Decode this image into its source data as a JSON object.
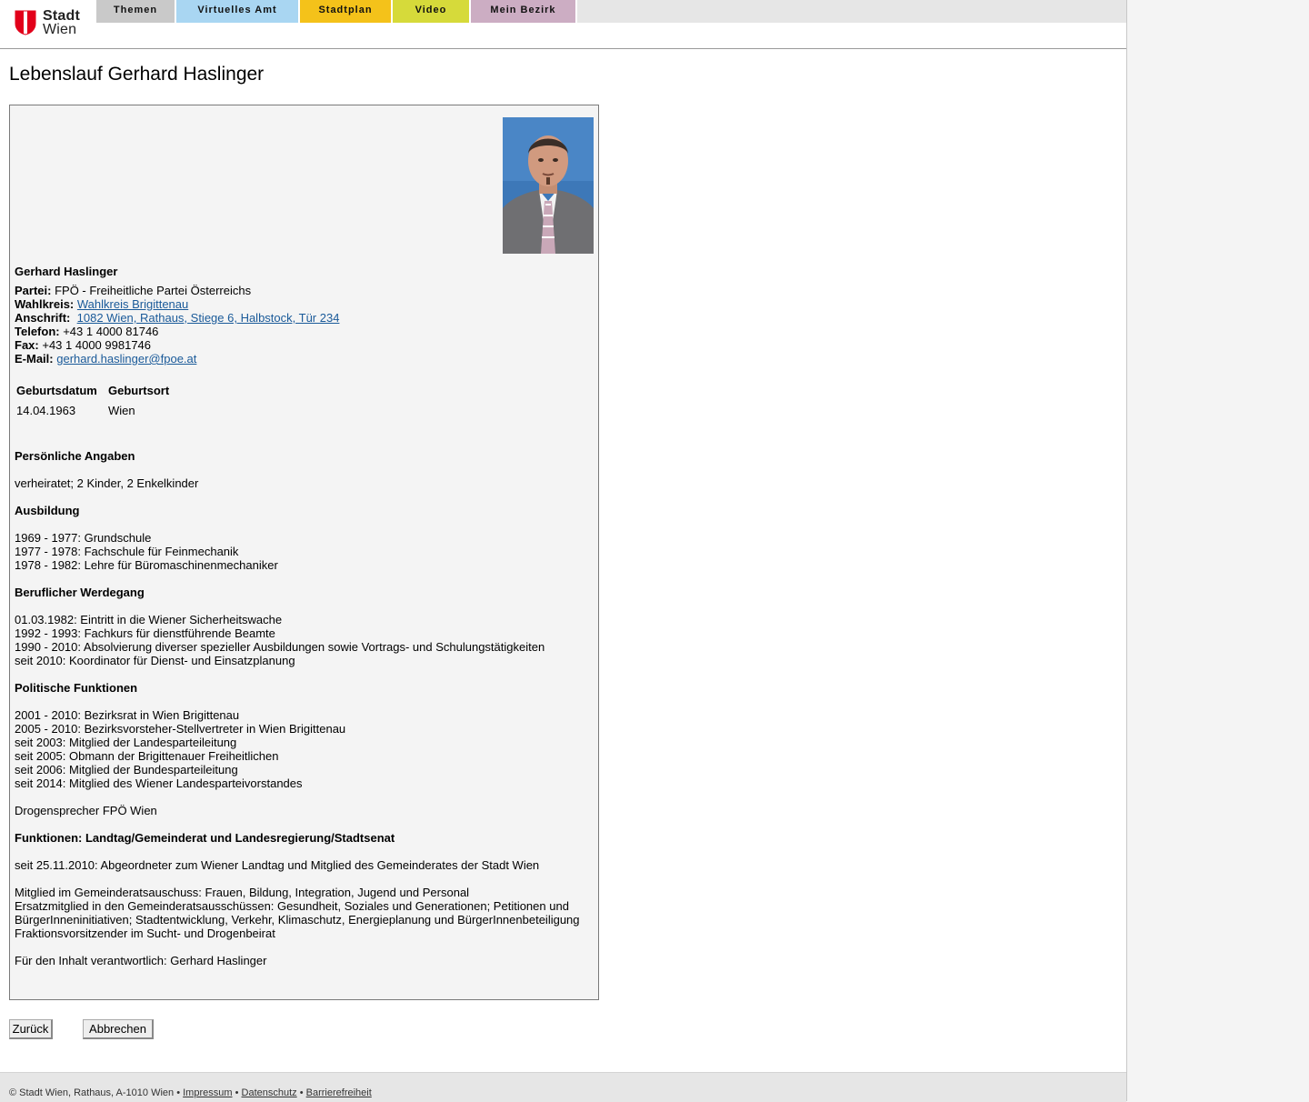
{
  "header": {
    "logo": {
      "line1": "Stadt",
      "line2": "Wien"
    },
    "tabs": [
      {
        "label": "Themen",
        "color": "#c9c9c9"
      },
      {
        "label": "Virtuelles Amt",
        "color": "#a9d6f2"
      },
      {
        "label": "Stadtplan",
        "color": "#f4c21a"
      },
      {
        "label": "Video",
        "color": "#d6da3a"
      },
      {
        "label": "Mein Bezirk",
        "color": "#ccadc3"
      }
    ]
  },
  "page_title": "Lebenslauf Gerhard Haslinger",
  "profile": {
    "name": "Gerhard Haslinger",
    "partei_label": "Partei:",
    "partei": "FPÖ - Freiheitliche Partei Österreichs",
    "wahlkreis_label": "Wahlkreis:",
    "wahlkreis": "Wahlkreis Brigittenau",
    "anschrift_label": "Anschrift:",
    "anschrift": "1082 Wien, Rathaus, Stiege 6, Halbstock, Tür 234",
    "telefon_label": "Telefon:",
    "telefon": "+43 1 4000 81746",
    "fax_label": "Fax:",
    "fax": "+43 1 4000 9981746",
    "email_label": "E-Mail:",
    "email": "gerhard.haslinger@fpoe.at"
  },
  "birth": {
    "headers": [
      "Geburtsdatum",
      "Geburtsort"
    ],
    "values": [
      "14.04.1963",
      "Wien"
    ]
  },
  "sections": {
    "personal_heading": "Persönliche Angaben",
    "personal_text": "verheiratet; 2 Kinder, 2 Enkelkinder",
    "education_heading": "Ausbildung",
    "education": [
      "1969 - 1977: Grundschule",
      "1977 - 1978: Fachschule für Feinmechanik",
      "1978 - 1982: Lehre für Büromaschinenmechaniker"
    ],
    "career_heading": "Beruflicher Werdegang",
    "career": [
      "01.03.1982: Eintritt in die Wiener Sicherheitswache",
      "1992 - 1993: Fachkurs für dienstführende Beamte",
      "1990 - 2010: Absolvierung diverser spezieller Ausbildungen sowie Vortrags- und Schulungstätigkeiten",
      "seit 2010: Koordinator für Dienst- und Einsatzplanung"
    ],
    "political_heading": "Politische Funktionen",
    "political": [
      "2001 - 2010: Bezirksrat in Wien Brigittenau",
      "2005 - 2010: Bezirksvorsteher-Stellvertreter in Wien Brigittenau",
      "seit 2003: Mitglied der Landesparteileitung",
      "seit 2005: Obmann der Brigittenauer Freiheitlichen",
      "seit 2006: Mitglied der Bundesparteileitung",
      "seit 2014: Mitglied des Wiener Landesparteivorstandes"
    ],
    "drogen": "Drogensprecher FPÖ Wien",
    "functions_heading": "Funktionen: Landtag/Gemeinderat und Landesregierung/Stadtsenat",
    "functions_text": "seit 25.11.2010: Abgeordneter zum Wiener Landtag und Mitglied des Gemeinderates der Stadt Wien",
    "committees": [
      "Mitglied im Gemeinderatsauschuss: Frauen, Bildung, Integration, Jugend und Personal",
      "Ersatzmitglied in den Gemeinderatsausschüssen: Gesundheit, Soziales und Generationen; Petitionen und",
      "BürgerInneninitiativen; Stadtentwicklung, Verkehr, Klimaschutz, Energieplanung und BürgerInnenbeteiligung",
      "Fraktionsvorsitzender im Sucht- und Drogenbeirat"
    ],
    "responsible": "Für den Inhalt verantwortlich: Gerhard Haslinger"
  },
  "buttons": {
    "back": "Zurück",
    "cancel": "Abbrechen"
  },
  "footer": {
    "copyright": "© Stadt Wien, Rathaus, A-1010 Wien",
    "sep": "•",
    "impressum": "Impressum",
    "datenschutz": "Datenschutz",
    "barrierefreiheit": "Barrierefreiheit"
  }
}
